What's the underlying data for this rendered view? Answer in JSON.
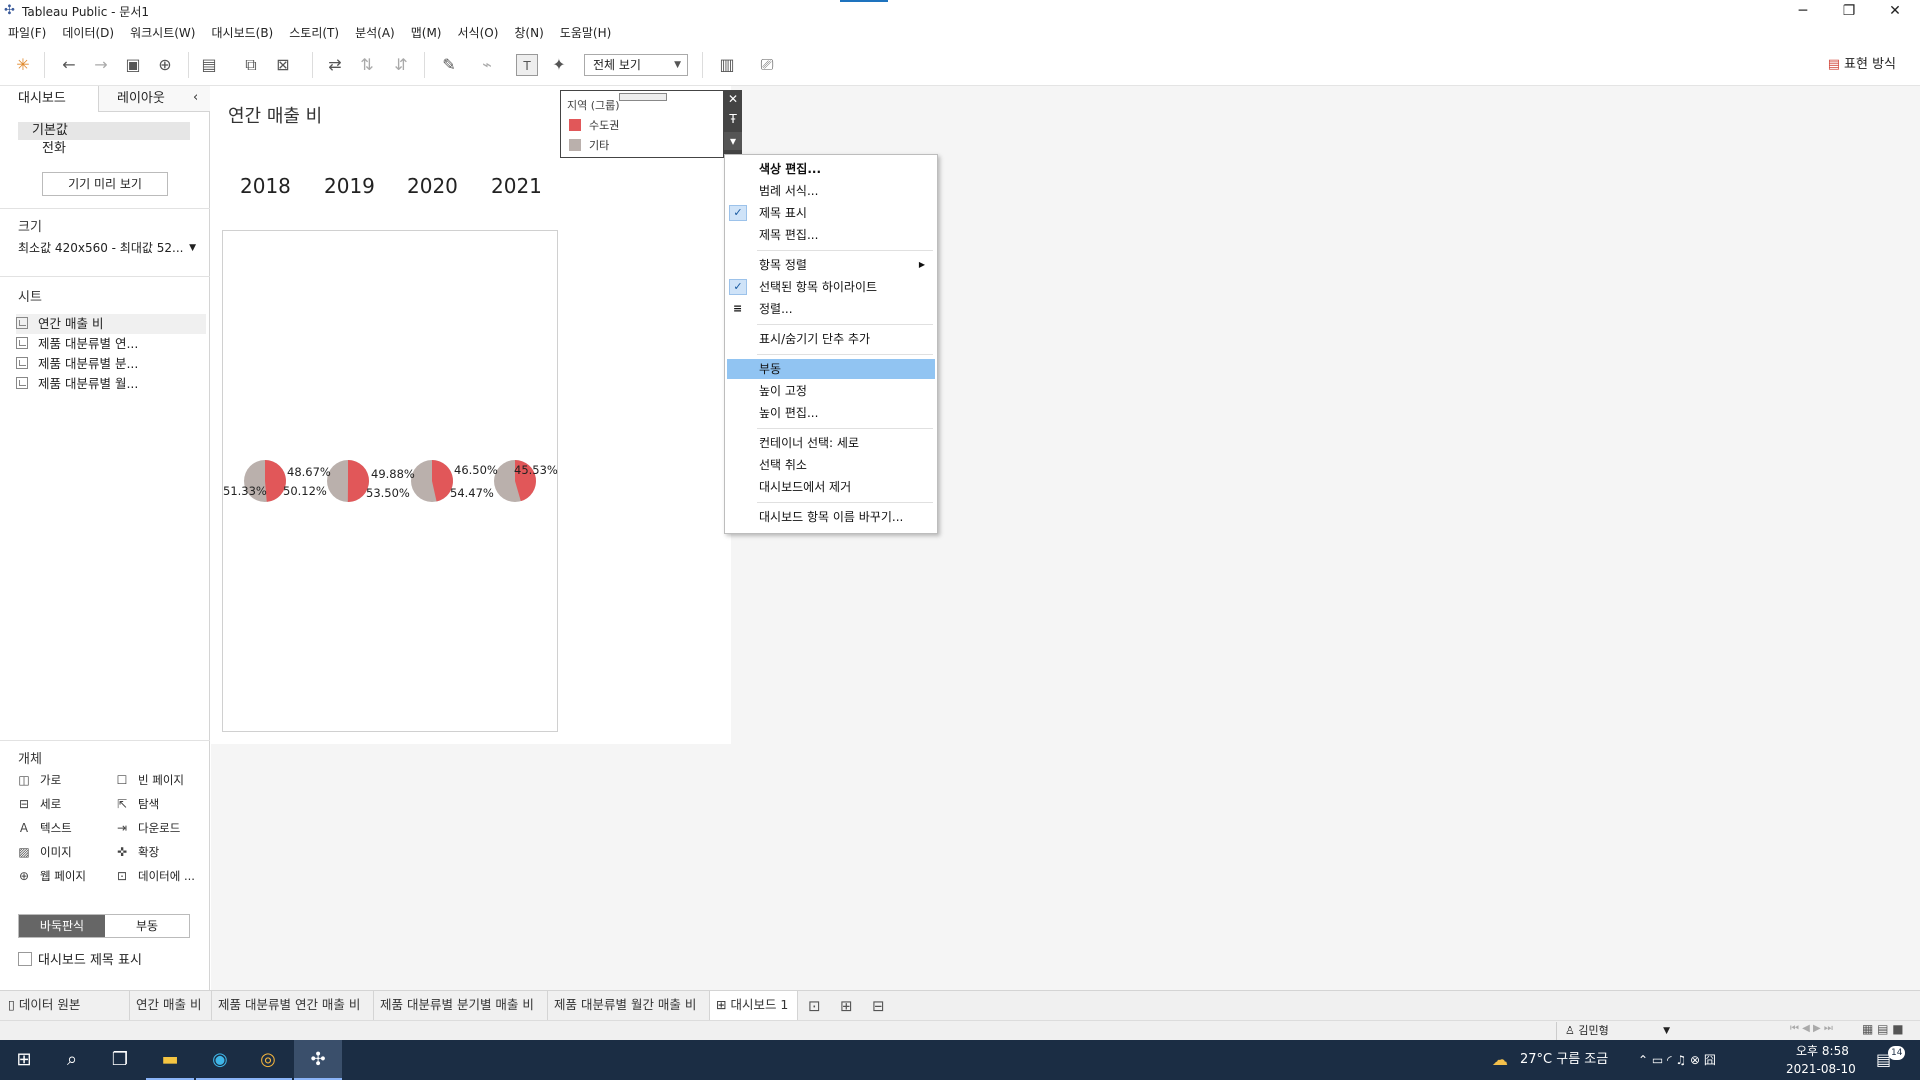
{
  "window": {
    "title": "Tableau Public - 문서1",
    "minimize": "─",
    "restore": "❐",
    "close": "✕"
  },
  "menu": [
    "파일(F)",
    "데이터(D)",
    "워크시트(W)",
    "대시보드(B)",
    "스토리(T)",
    "분석(A)",
    "맵(M)",
    "서식(O)",
    "창(N)",
    "도움말(H)"
  ],
  "toolbar": {
    "view_select": "전체 보기",
    "show_me": "표현 방식"
  },
  "left_panel": {
    "tab_dashboard": "대시보드",
    "tab_layout": "레이아웃",
    "devices": [
      "기본값",
      "전화"
    ],
    "preview_button": "기기 미리 보기",
    "size_title": "크기",
    "size_value": "최소값 420x560 - 최대값 52...",
    "sheets_title": "시트",
    "sheets": [
      "연간 매출 비",
      "제품 대분류별 연...",
      "제품 대분류별 분...",
      "제품 대분류별 월..."
    ],
    "objects_title": "개체",
    "objects": [
      "가로",
      "빈 페이지",
      "세로",
      "탐색",
      "텍스트",
      "다운로드",
      "이미지",
      "확장",
      "웹 페이지",
      "데이터에 ..."
    ],
    "mode_tiled": "바둑판식",
    "mode_floating": "부동",
    "show_title": "대시보드 제목 표시"
  },
  "dashboard": {
    "title": "연간 매출 비",
    "years": [
      "2018",
      "2019",
      "2020",
      "2021"
    ]
  },
  "chart_data": {
    "type": "pie",
    "categories": [
      "2018",
      "2019",
      "2020",
      "2021"
    ],
    "series": [
      {
        "name": "수도권",
        "values": [
          48.67,
          50.12,
          46.5,
          45.53
        ]
      },
      {
        "name": "기타",
        "values": [
          51.33,
          49.88,
          53.5,
          54.47
        ]
      }
    ],
    "labels_first_row": [
      "48.67%",
      "49.88%",
      "46.50%",
      "45.53%"
    ],
    "labels_second_row": [
      "51.33%",
      "50.12%",
      "53.50%",
      "54.47%"
    ],
    "colors": {
      "수도권": "#e15759",
      "기타": "#bab0ac"
    }
  },
  "legend": {
    "title": "지역 (그룹)",
    "items": [
      {
        "label": "수도권",
        "color": "#e15759"
      },
      {
        "label": "기타",
        "color": "#bab0ac"
      }
    ],
    "close": "✕",
    "pin": "Ŧ",
    "more": "▾"
  },
  "context_menu": {
    "items": [
      {
        "label": "색상 편집...",
        "bold": true
      },
      {
        "label": "범례 서식..."
      },
      {
        "label": "제목 표시",
        "checked": true
      },
      {
        "label": "제목 편집..."
      },
      {
        "label": "항목 정렬",
        "submenu": true
      },
      {
        "label": "선택된 항목 하이라이트",
        "checked": true
      },
      {
        "label": "정렬..."
      },
      {
        "label": "표시/숨기기 단추 추가"
      },
      {
        "label": "부동",
        "highlighted": true
      },
      {
        "label": "높이 고정"
      },
      {
        "label": "높이 편집..."
      },
      {
        "label": "컨테이너 선택: 세로"
      },
      {
        "label": "선택 취소"
      },
      {
        "label": "대시보드에서 제거"
      },
      {
        "label": "대시보드 항목 이름 바꾸기..."
      }
    ]
  },
  "sheet_tabs": [
    "데이터 원본",
    "연간 매출 비",
    "제품 대분류별 연간 매출 비",
    "제품 대분류별 분기별 매출 비",
    "제품 대분류별 월간 매출 비",
    "대시보드 1"
  ],
  "status": {
    "user": "김민형"
  },
  "taskbar": {
    "weather": "27°C 구름 조금",
    "time": "오후 8:58",
    "date": "2021-08-10",
    "notifications": "14"
  }
}
